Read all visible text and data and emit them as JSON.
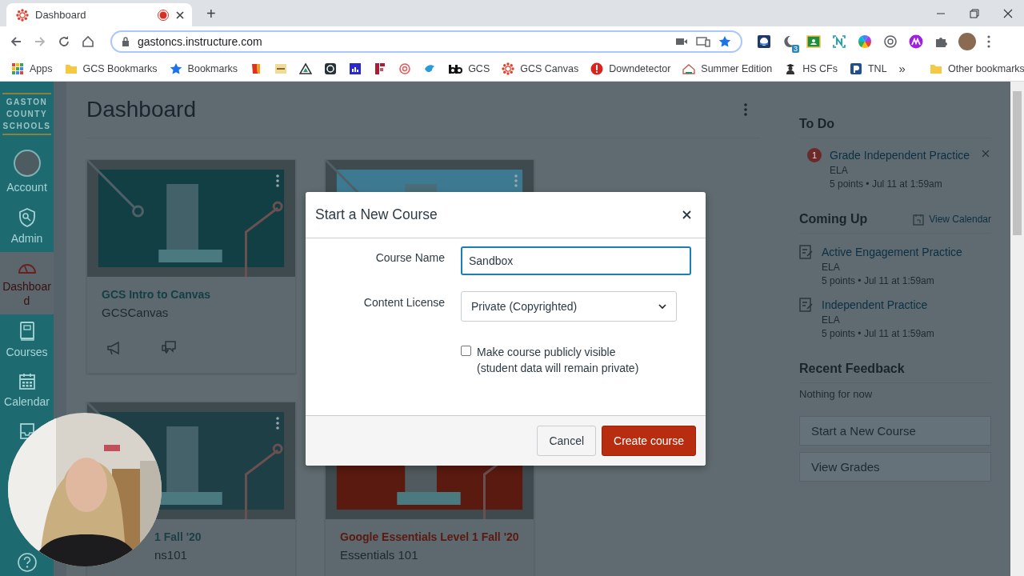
{
  "browser": {
    "tab": {
      "title": "Dashboard",
      "recording": true
    },
    "new_tab": "+",
    "url": "gastoncs.instructure.com",
    "extension_badge": "3",
    "bookmarks": [
      {
        "kind": "apps",
        "label": "Apps"
      },
      {
        "kind": "folder",
        "label": "GCS Bookmarks"
      },
      {
        "kind": "star",
        "label": "Bookmarks"
      },
      {
        "kind": "book"
      },
      {
        "kind": "itf"
      },
      {
        "kind": "triangle"
      },
      {
        "kind": "at"
      },
      {
        "kind": "bars"
      },
      {
        "kind": "grid"
      },
      {
        "kind": "swirl"
      },
      {
        "kind": "bird"
      },
      {
        "kind": "bb",
        "label": "GCS"
      },
      {
        "kind": "canvas",
        "label": "GCS Canvas"
      },
      {
        "kind": "alert",
        "label": "Downdetector"
      },
      {
        "kind": "house",
        "label": "Summer Edition"
      },
      {
        "kind": "person",
        "label": "HS CFs"
      },
      {
        "kind": "p",
        "label": "TNL"
      }
    ],
    "overflow": "»",
    "other_bookmarks": "Other bookmarks"
  },
  "logo": [
    "GASTON",
    "COUNTY",
    "SCHOOLS"
  ],
  "nav": [
    {
      "kind": "avatar",
      "label": "Account",
      "selected": false
    },
    {
      "kind": "admin",
      "label": "Admin",
      "selected": false
    },
    {
      "kind": "dashboard",
      "label": "Dashboard",
      "selected": true
    },
    {
      "kind": "courses",
      "label": "Courses",
      "selected": false
    },
    {
      "kind": "calendar",
      "label": "Calendar",
      "selected": false
    },
    {
      "kind": "inbox",
      "selected": false
    },
    {
      "kind": "help",
      "selected": false
    }
  ],
  "heading": "Dashboard",
  "cards": [
    {
      "color": "#123f44",
      "title": "GCS Intro to Canvas",
      "code": "GCSCanvas",
      "actions": true
    },
    {
      "color": "#3d7a92",
      "actions": false
    },
    {
      "color": "#1e3f46",
      "title": "1 Fall '20",
      "code": "ns101",
      "actions": false
    },
    {
      "color": "#5a1a10",
      "title": "Google Essentials Level 1 Fall '20",
      "code": "Essentials 101",
      "actions": false
    }
  ],
  "todo": {
    "title": "To Do",
    "items": [
      {
        "badge": "1",
        "title": "Grade Independent Practice",
        "course": "ELA",
        "details": "5 points • Jul 11 at 1:59am"
      }
    ]
  },
  "coming_up": {
    "title": "Coming Up",
    "link": "View Calendar",
    "items": [
      {
        "title": "Active Engagement Practice",
        "course": "ELA",
        "details": "5 points • Jul 11 at 1:59am"
      },
      {
        "title": "Independent Practice",
        "course": "ELA",
        "details": "5 points • Jul 11 at 1:59am"
      }
    ]
  },
  "feedback": {
    "title": "Recent Feedback",
    "empty": "Nothing for now"
  },
  "aside_buttons": [
    "Start a New Course",
    "View Grades"
  ],
  "dialog": {
    "title": "Start a New Course",
    "course_name": {
      "label": "Course Name",
      "value": "Sandbox"
    },
    "license": {
      "label": "Content License",
      "value": "Private (Copyrighted)"
    },
    "public": {
      "checked": false,
      "lines": [
        "Make course publicly visible",
        "(student data will remain private)"
      ]
    },
    "buttons": [
      {
        "kind": "secondary",
        "label": "Cancel"
      },
      {
        "kind": "primary",
        "label": "Create course"
      }
    ]
  },
  "webcam": {
    "kind": "picture"
  }
}
